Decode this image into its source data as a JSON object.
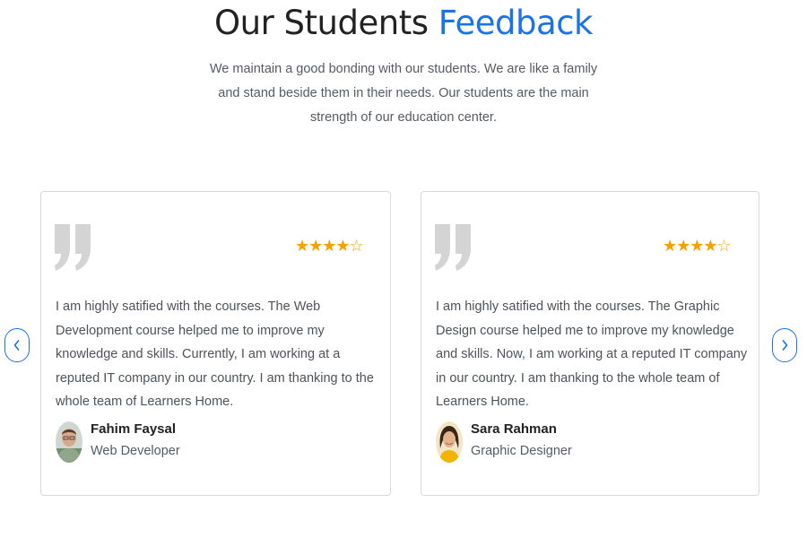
{
  "section": {
    "title_part1": "Our Students",
    "title_part2": "Feedback",
    "subtitle": "We maintain a good bonding with our students. We are like a family and stand beside them in their needs. Our students are the main strength of our education center."
  },
  "colors": {
    "accent": "#1a73e8",
    "star": "#f5a100",
    "quote": "#d4d4d4"
  },
  "nav": {
    "prev_icon": "chevron-left-icon",
    "next_icon": "chevron-right-icon"
  },
  "testimonials": [
    {
      "rating": 4,
      "max_rating": 5,
      "stars": "★★★★☆",
      "text": "I am highly satified with the courses. The Web Development course helped me to improve my knowledge and skills. Currently, I am working at a reputed IT company in our country. I am thanking to the whole team of Learners Home.",
      "name": "Fahim Faysal",
      "role": "Web Developer"
    },
    {
      "rating": 4,
      "max_rating": 5,
      "stars": "★★★★☆",
      "text": "I am highly satified with the courses. The Graphic Design course helped me to improve my knowledge and skills. Now, I am working at a reputed IT company in our country. I am thanking to the whole team of Learners Home.",
      "name": "Sara Rahman",
      "role": "Graphic Designer"
    }
  ]
}
